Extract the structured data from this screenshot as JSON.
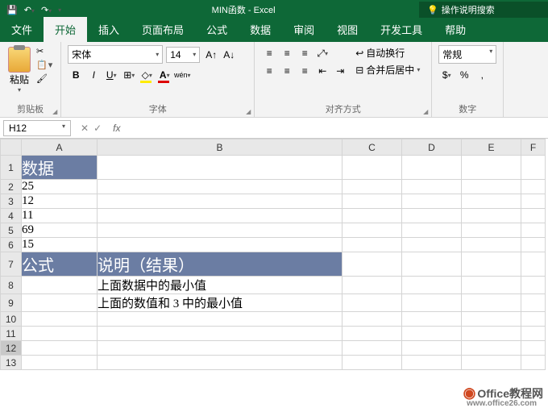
{
  "app": {
    "title": "MIN函数 - Excel",
    "search_placeholder": "操作说明搜索"
  },
  "tabs": {
    "file": "文件",
    "home": "开始",
    "insert": "插入",
    "layout": "页面布局",
    "formulas": "公式",
    "data": "数据",
    "review": "审阅",
    "view": "视图",
    "dev": "开发工具",
    "help": "帮助"
  },
  "ribbon": {
    "clipboard": {
      "label": "剪贴板",
      "paste": "粘贴"
    },
    "font": {
      "label": "字体",
      "name": "宋体",
      "size": "14"
    },
    "align": {
      "label": "对齐方式",
      "wrap": "自动换行",
      "merge": "合并后居中"
    },
    "number": {
      "label": "数字",
      "format": "常规"
    }
  },
  "namebox": {
    "cell": "H12"
  },
  "columns": {
    "A": "A",
    "B": "B",
    "C": "C",
    "D": "D",
    "E": "E",
    "F": "F"
  },
  "cells": {
    "A1": "数据",
    "A2": "25",
    "A3": "12",
    "A4": "11",
    "A5": "69",
    "A6": "15",
    "A7": "公式",
    "B7": "说明（结果）",
    "B8": "上面数据中的最小值",
    "B9": "上面的数值和 3 中的最小值"
  },
  "watermark": {
    "brand": "Office教程网",
    "url": "www.office26.com"
  }
}
